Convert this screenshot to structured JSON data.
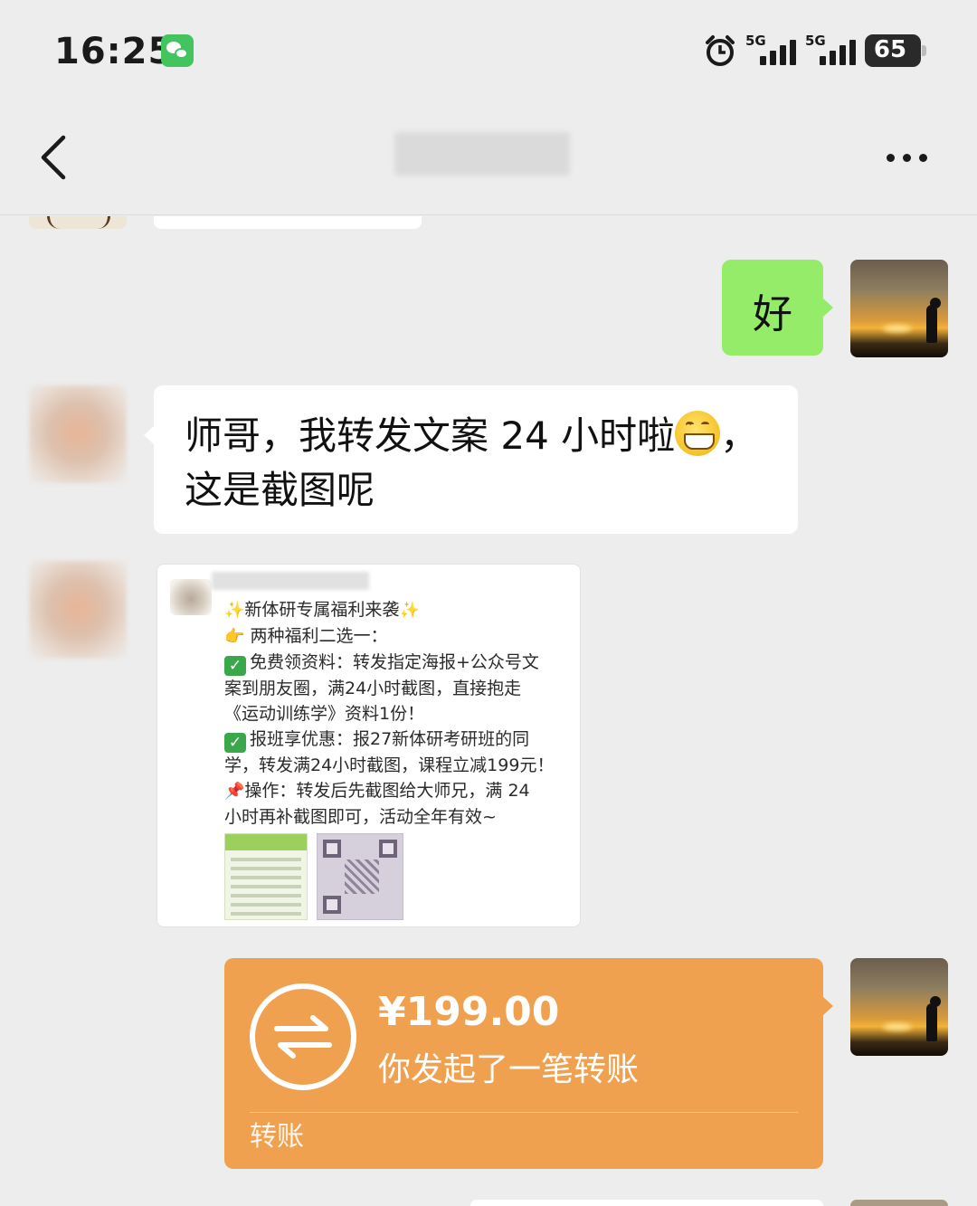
{
  "status_bar": {
    "time": "16:25",
    "signal_1_label": "5G",
    "signal_2_label": "5G",
    "battery": "65",
    "icons": [
      "wechat-notification-icon",
      "alarm-icon",
      "signal-icon",
      "battery-icon"
    ]
  },
  "header": {
    "back_icon": "chevron-left-icon",
    "more_icon": "more-icon"
  },
  "messages": {
    "sent_text": "好",
    "received_text_line1": "师哥，我转发文案 24 小时啦",
    "received_text_line1_end": "，",
    "received_text_line2": "这是截图呢",
    "received_emoji": "grinning-face-emoji",
    "screenshot_post": {
      "line1": "新体研专属福利来袭",
      "line2": "两种福利二选一：",
      "line3": "免费领资料：转发指定海报+公众号文",
      "line4": "案到朋友圈，满24小时截图，直接抱走",
      "line5": "《运动训练学》资料1份！",
      "line6": "报班享优惠：报27新体研考研班的同",
      "line7": "学，转发满24小时截图，课程立减199元！",
      "line8": "操作：转发后先截图给大师兄，满 24",
      "line9": "小时再补截图即可，活动全年有效~"
    },
    "transfer": {
      "amount": "¥199.00",
      "description": "你发起了一笔转账",
      "label": "转账",
      "color": "#f0a14f"
    }
  },
  "colors": {
    "background": "#ededed",
    "sent_bubble": "#95ec69",
    "received_bubble": "#ffffff"
  }
}
